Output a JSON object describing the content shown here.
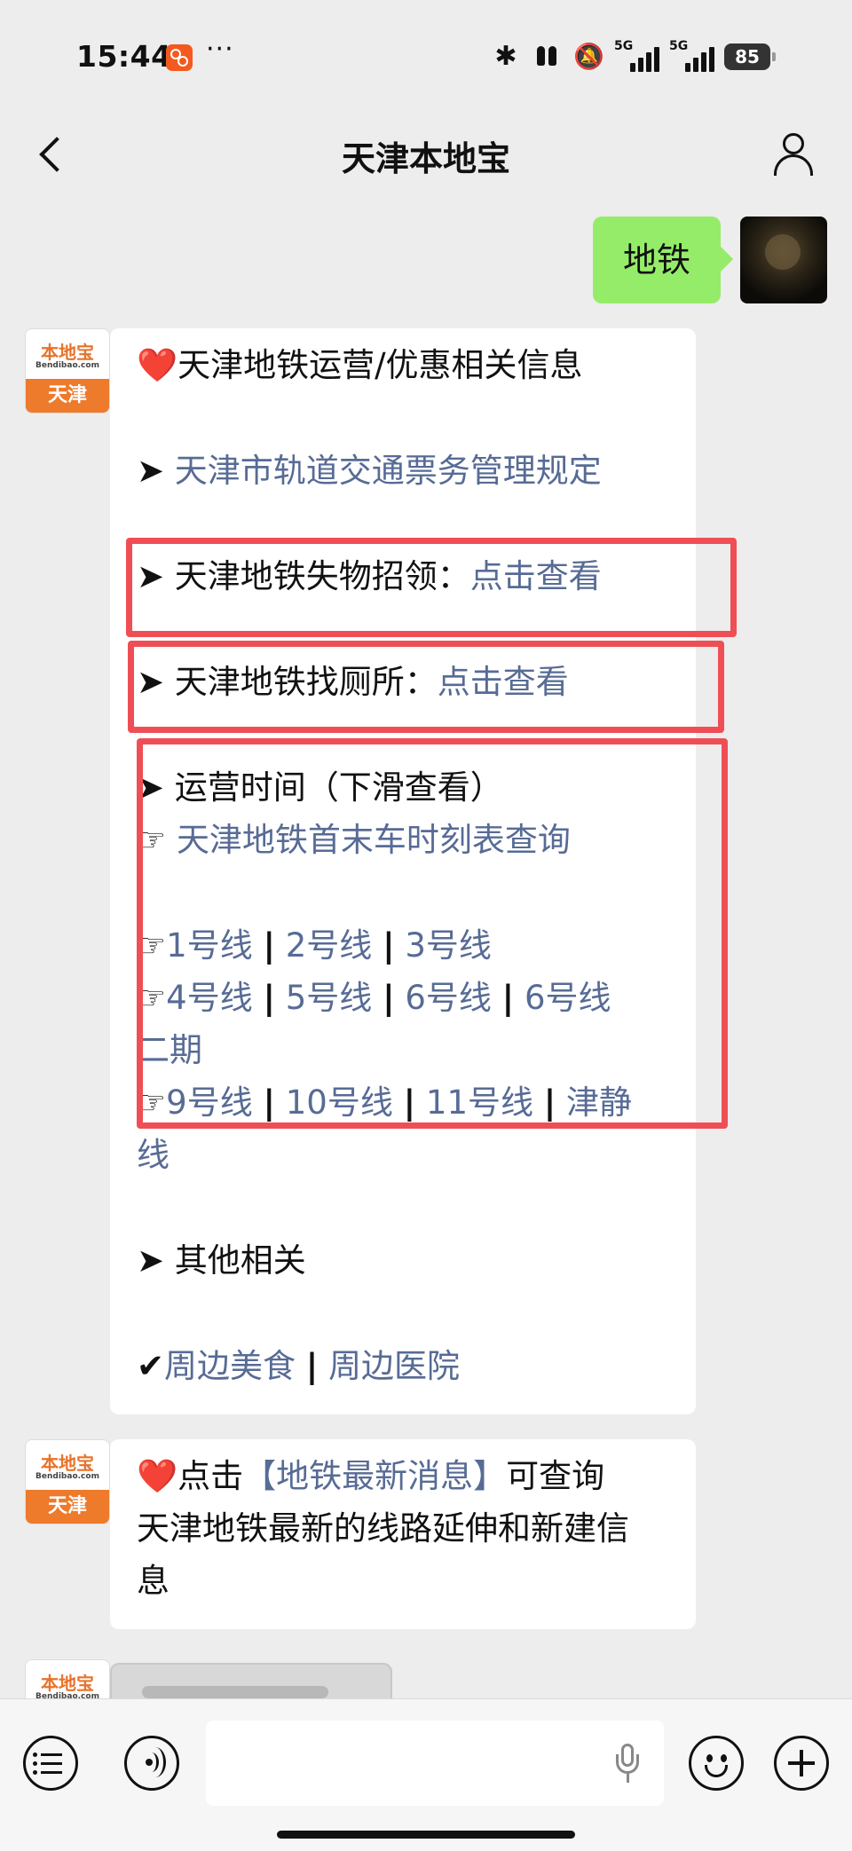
{
  "status_bar": {
    "time": "15:44",
    "more": "···",
    "signal_1": "5G",
    "signal_2": "5G",
    "battery": "85",
    "bluetooth_glyph": "✱",
    "mute_glyph": "🔕"
  },
  "nav": {
    "title": "天津本地宝"
  },
  "chat": {
    "sent": {
      "text": "地铁"
    },
    "bot_avatar": {
      "logo": "本地宝",
      "sub": "Bendibao.com",
      "city": "天津"
    },
    "message1": {
      "heart": "❤️",
      "title": "天津地铁运营/优惠相关信息",
      "arrow": "➤",
      "hand": "☞",
      "check": "✔",
      "pipe": "|",
      "rules_link": "天津市轨道交通票务管理规定",
      "lost_found_label": "天津地铁失物招领：",
      "lost_found_link": "点击查看",
      "toilet_label": "天津地铁找厕所：",
      "toilet_link": "点击查看",
      "hours_label": "运营时间（下滑查看）",
      "timetable_link": "天津地铁首末车时刻表查询",
      "lines_row1": [
        "1号线",
        "2号线",
        "3号线"
      ],
      "lines_row2": [
        "4号线",
        "5号线",
        "6号线",
        "6号线"
      ],
      "lines_row2_wrap": "二期",
      "lines_row3": [
        "9号线",
        "10号线",
        "11号线",
        "津静"
      ],
      "lines_row3_wrap": "线",
      "other_label": "其他相关",
      "food_link": "周边美食",
      "hospital_link": "周边医院"
    },
    "message2": {
      "heart": "❤️",
      "prefix": "点击",
      "link": "【地铁最新消息】",
      "suffix": "可查询",
      "line2": "天津地铁最新的线路延伸和新建信",
      "line3": "息"
    }
  },
  "input": {
    "placeholder": ""
  }
}
